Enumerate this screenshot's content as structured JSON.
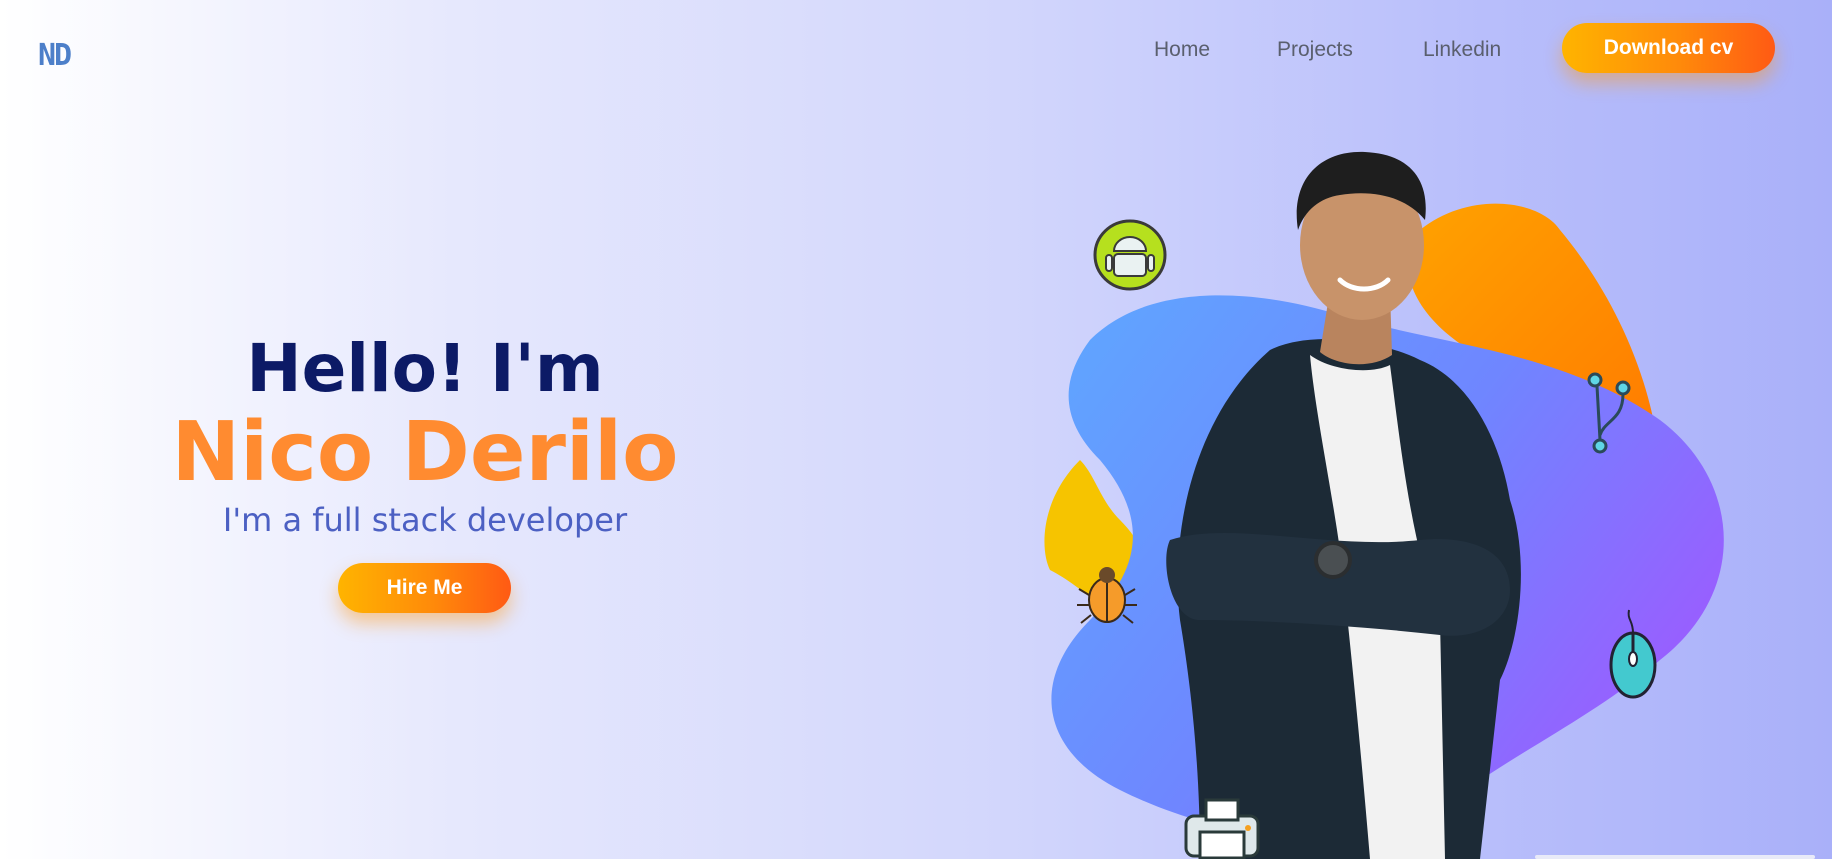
{
  "header": {
    "logo_text": "ND",
    "nav": [
      "Home",
      "Projects",
      "Linkedin"
    ],
    "download_label": "Download cv"
  },
  "hero": {
    "greeting": "Hello! I'm",
    "name": "Nico Derilo",
    "tagline": "I'm a full stack developer",
    "hire_label": "Hire Me"
  },
  "illustration": {
    "icons": [
      "android-icon",
      "git-branch-icon",
      "bug-icon",
      "mouse-icon",
      "printer-icon"
    ]
  },
  "colors": {
    "accent_orange": "#ff8b30",
    "heading_navy": "#0c1a66",
    "tagline_blue": "#4c60c3",
    "blob_orange": "#ff8c00",
    "blob_yellow": "#f6c400",
    "blob_blue": "#5ea2ff",
    "blob_purple": "#8b64ff"
  }
}
